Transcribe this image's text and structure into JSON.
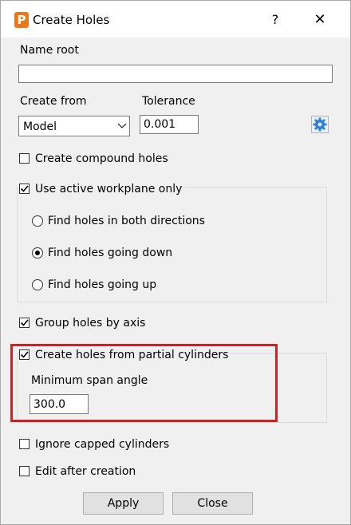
{
  "window": {
    "title": "Create Holes",
    "help": "?",
    "close": "✕",
    "app_icon_letter": "P",
    "accent": "#e8781c"
  },
  "name_root": {
    "label": "Name root",
    "value": ""
  },
  "create_from": {
    "label": "Create from",
    "selected": "Model"
  },
  "tolerance": {
    "label": "Tolerance",
    "value": "0.001"
  },
  "settings_icon": "gear-icon",
  "compound": {
    "label": "Create compound holes",
    "checked": false
  },
  "workplane": {
    "label": "Use active workplane only",
    "checked": true,
    "options": [
      {
        "label": "Find holes in both directions",
        "selected": false
      },
      {
        "label": "Find holes going down",
        "selected": true
      },
      {
        "label": "Find holes going up",
        "selected": false
      }
    ]
  },
  "group_axis": {
    "label": "Group holes by axis",
    "checked": true
  },
  "partial": {
    "label": "Create holes from partial cylinders",
    "checked": true,
    "span_label": "Minimum span angle",
    "span_value": "300.0",
    "highlight_color": "#d11f26"
  },
  "ignore_capped": {
    "label": "Ignore capped cylinders",
    "checked": false
  },
  "edit_after": {
    "label": "Edit after creation",
    "checked": false
  },
  "buttons": {
    "apply": "Apply",
    "close": "Close"
  }
}
